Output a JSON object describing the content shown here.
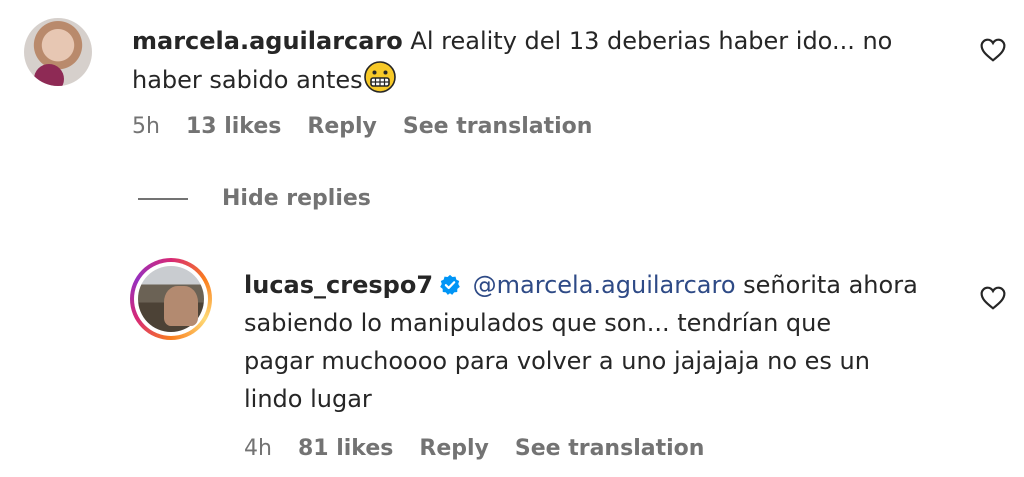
{
  "comments": [
    {
      "username": "marcela.aguilarcaro",
      "text_line1": "Al reality del 13 deberias haber ido... no",
      "text_line2": "haber sabido antes",
      "emoji_icon": "grimacing-face-emoji",
      "time": "5h",
      "likes": "13 likes",
      "reply_label": "Reply",
      "translation_label": "See translation"
    },
    {
      "username": "lucas_crespo7",
      "verified": true,
      "mention": "@marcela.aguilarcaro",
      "text_line1": "señorita ahora",
      "text_line2": "sabiendo lo manipulados que son... tendrían que",
      "text_line3": "pagar muchoooo para volver a uno jajajaja no es un",
      "text_line4": "lindo lugar",
      "time": "4h",
      "likes": "81 likes",
      "reply_label": "Reply",
      "translation_label": "See translation"
    }
  ],
  "hide_replies_label": "Hide replies",
  "colors": {
    "text": "#262626",
    "meta": "#737373",
    "mention": "#2e4a86",
    "verified": "#0095f6"
  }
}
